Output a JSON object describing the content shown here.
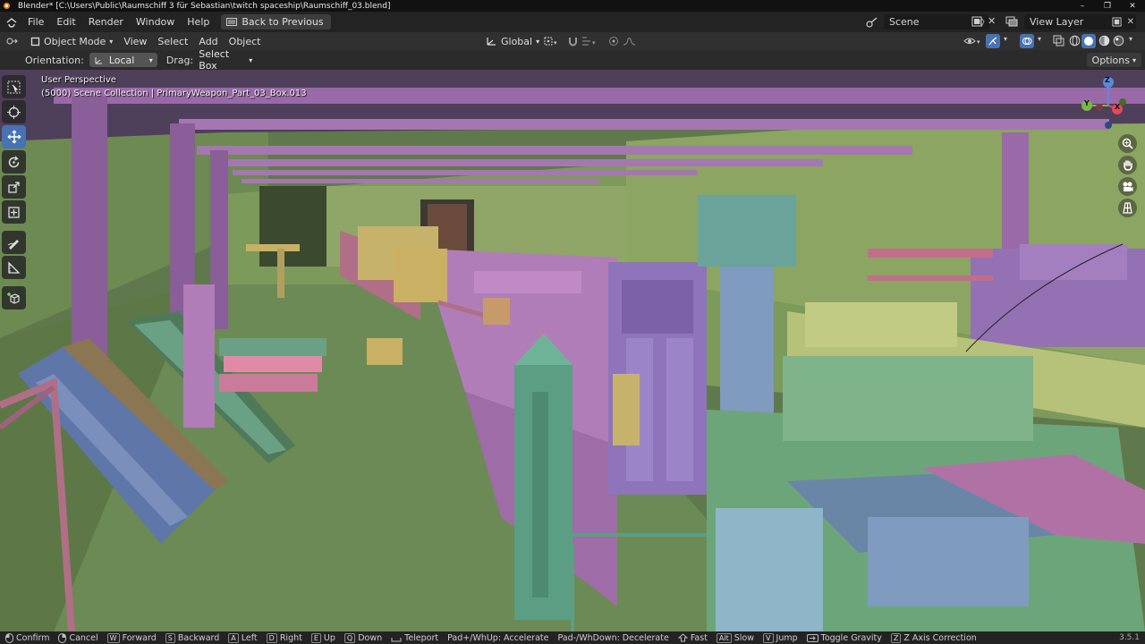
{
  "window": {
    "title": "Blender* [C:\\Users\\Public\\Raumschiff 3 für Sebastian\\twitch spaceship\\Raumschiff_03.blend]",
    "controls": [
      "–",
      "❐",
      "✕"
    ]
  },
  "menu": {
    "items": [
      "File",
      "Edit",
      "Render",
      "Window",
      "Help"
    ],
    "back_button": "Back to Previous",
    "scene": "Scene",
    "view_layer": "View Layer"
  },
  "header": {
    "mode": "Object Mode",
    "menus": [
      "View",
      "Select",
      "Add",
      "Object"
    ],
    "transform_orientation": "Global"
  },
  "toolsettings": {
    "orientation_label": "Orientation:",
    "orientation_value": "Local",
    "drag_label": "Drag:",
    "drag_value": "Select Box",
    "options": "Options"
  },
  "viewport": {
    "perspective": "User Perspective",
    "collection_info": "(5000) Scene Collection | PrimaryWeapon_Part_03_Box.013",
    "gizmo_axes": [
      "Z",
      "Y",
      "X"
    ]
  },
  "status": {
    "hints": [
      {
        "key": "",
        "label": "Confirm"
      },
      {
        "key": "",
        "label": "Cancel"
      },
      {
        "key": "W",
        "label": "Forward"
      },
      {
        "key": "S",
        "label": "Backward"
      },
      {
        "key": "A",
        "label": "Left"
      },
      {
        "key": "D",
        "label": "Right"
      },
      {
        "key": "E",
        "label": "Up"
      },
      {
        "key": "Q",
        "label": "Down"
      },
      {
        "key": "",
        "label": "Teleport"
      },
      {
        "key": "",
        "label": "Pad+/WhUp: Accelerate"
      },
      {
        "key": "",
        "label": "Pad-/WhDown: Decelerate"
      },
      {
        "key": "",
        "label": "Fast"
      },
      {
        "key": "Alt",
        "label": "Slow"
      },
      {
        "key": "V",
        "label": "Jump"
      },
      {
        "key": "",
        "label": "Toggle Gravity"
      },
      {
        "key": "Z",
        "label": "Z Axis Correction"
      }
    ],
    "version": "3.5.1"
  },
  "colors": {
    "accent": "#4772b3",
    "green_wall": "#8fa668",
    "purple_frame": "#9a6aa8",
    "pink_rail": "#b06f86",
    "blue_machine": "#7f9bc0",
    "teal_part": "#5c9e84"
  }
}
